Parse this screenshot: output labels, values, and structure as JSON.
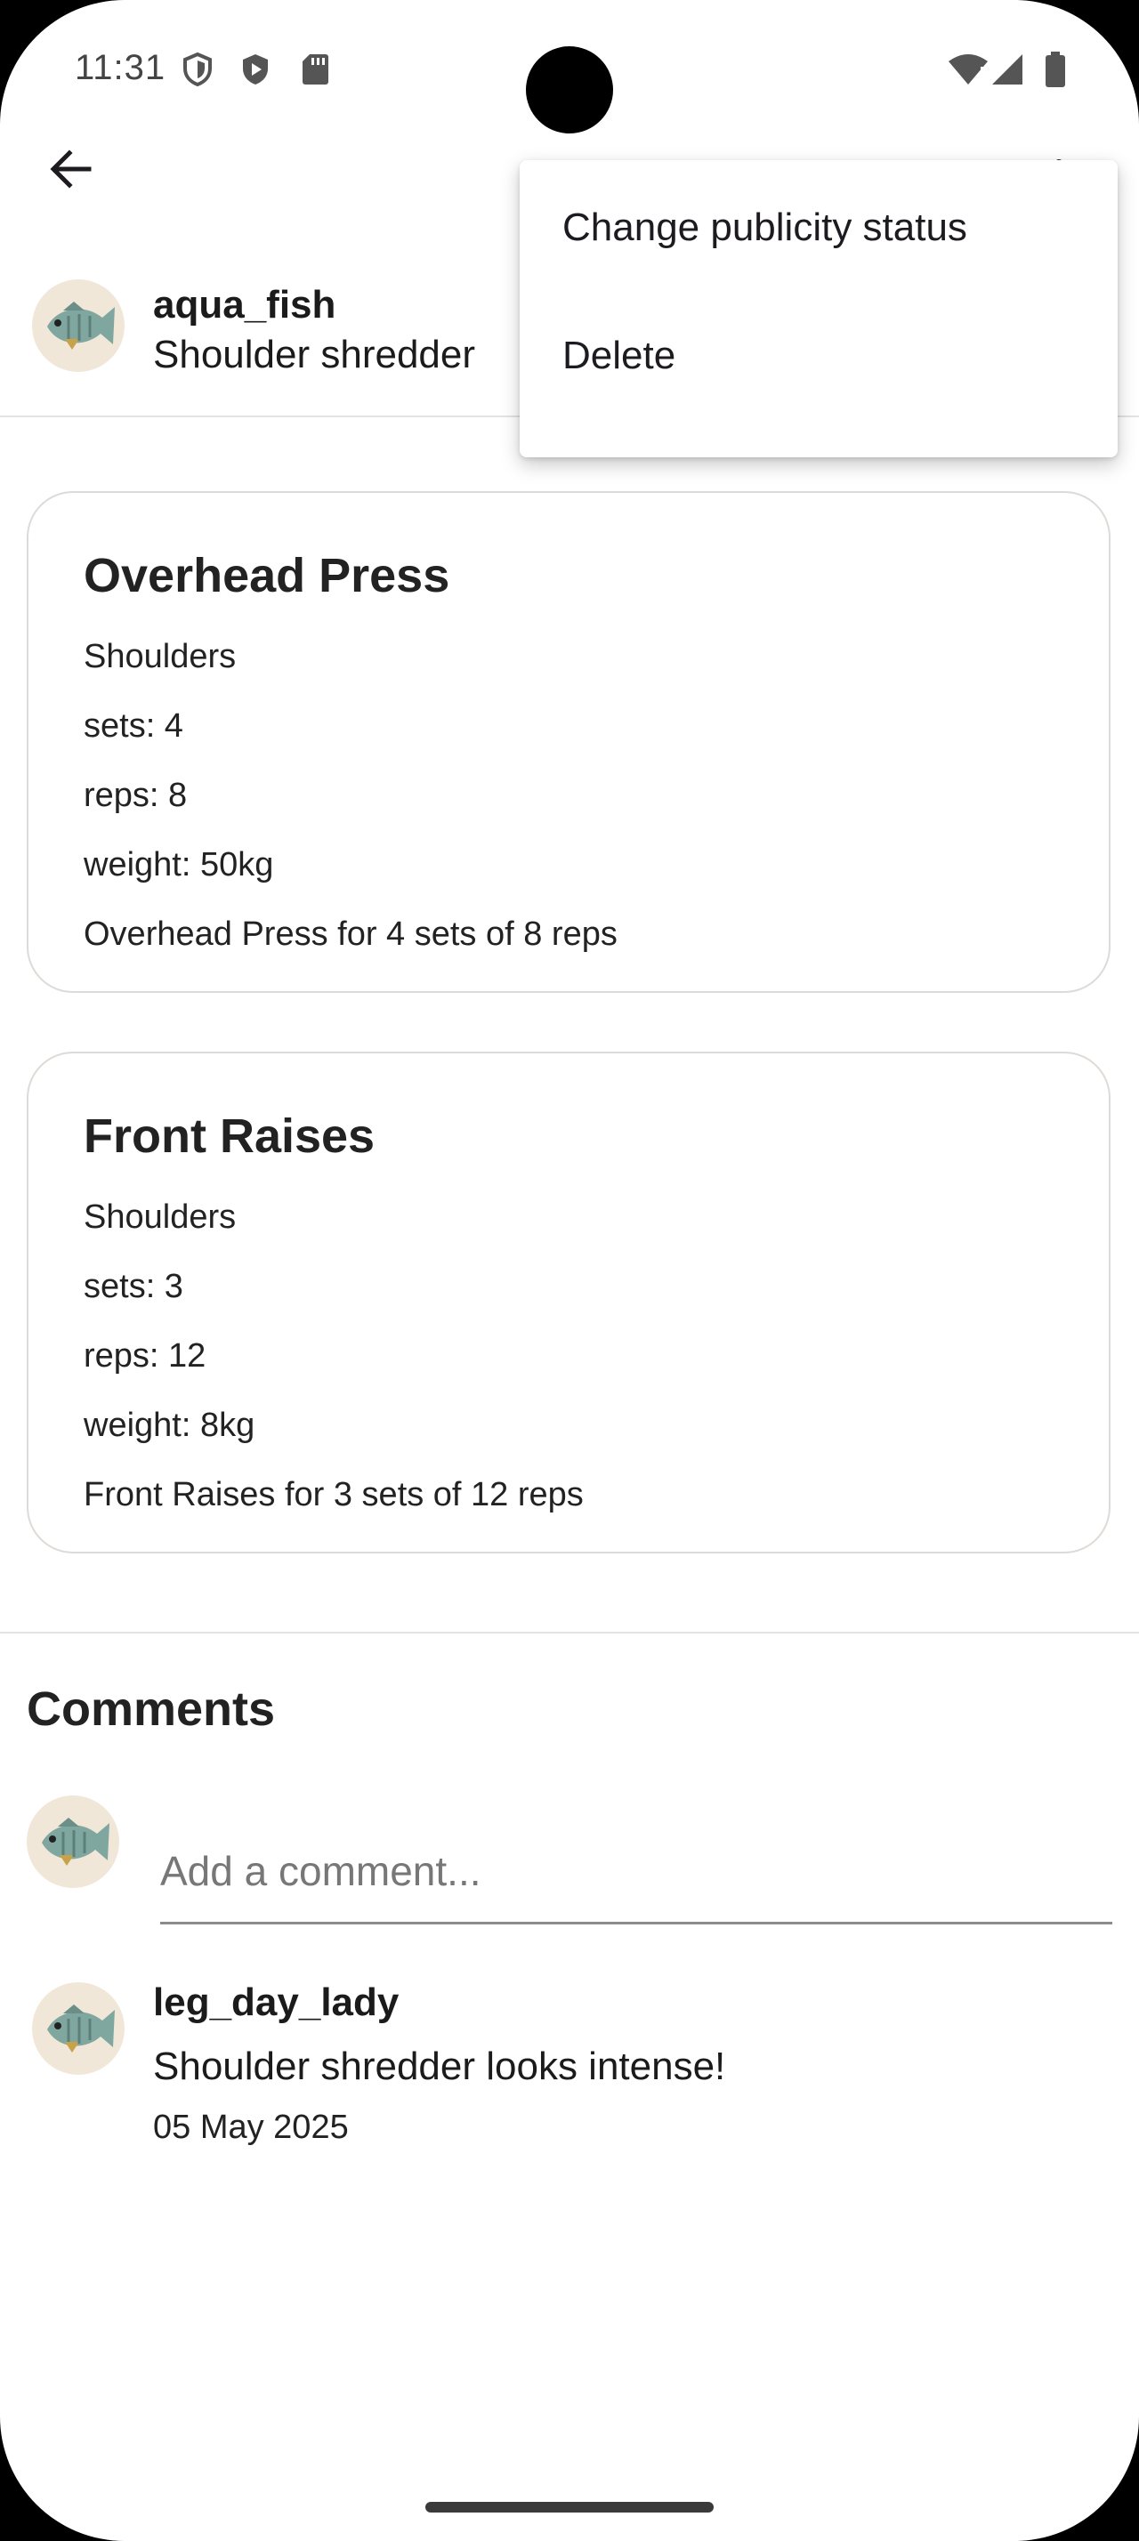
{
  "status_bar": {
    "time": "11:31",
    "icons_left": [
      "shield-outline-icon",
      "shield-play-icon",
      "sd-card-icon"
    ],
    "icons_right": [
      "wifi-alert-icon",
      "signal-icon",
      "battery-icon"
    ]
  },
  "app_bar": {
    "back_icon": "arrow-left-icon",
    "more_icon": "more-vert-icon"
  },
  "post": {
    "username": "aqua_fish",
    "title": "Shoulder shredder",
    "avatar": "fish-avatar"
  },
  "menu": {
    "items": [
      {
        "label": "Change publicity status"
      },
      {
        "label": "Delete"
      }
    ]
  },
  "exercises": [
    {
      "name": "Overhead Press",
      "muscle": "Shoulders",
      "sets": "sets: 4",
      "reps": "reps: 8",
      "weight": "weight: 50kg",
      "summary": "Overhead Press for 4 sets of 8 reps"
    },
    {
      "name": "Front Raises",
      "muscle": "Shoulders",
      "sets": "sets: 3",
      "reps": "reps: 12",
      "weight": "weight: 8kg",
      "summary": "Front Raises for 3 sets of 12 reps"
    }
  ],
  "comments": {
    "heading": "Comments",
    "input_placeholder": "Add a comment...",
    "input_value": "",
    "items": [
      {
        "author": "leg_day_lady",
        "text": "Shoulder shredder looks intense!",
        "date": "05 May 2025"
      }
    ]
  },
  "colors": {
    "background": "#ffffff",
    "card_border": "#dedad7",
    "divider": "#e6e1e5",
    "text": "#1d1b20",
    "avatar_bg": "#f1e7d8"
  }
}
